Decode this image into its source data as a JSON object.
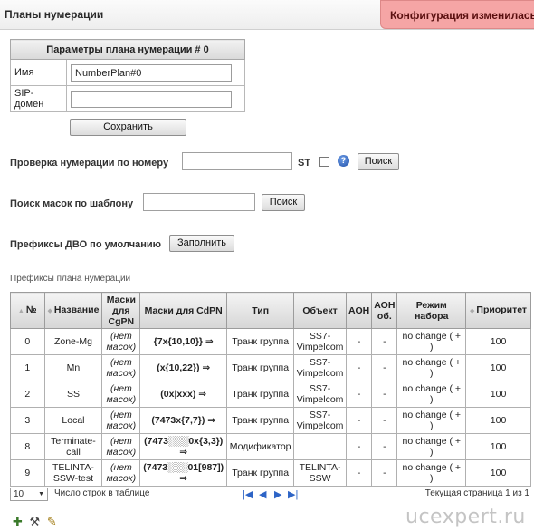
{
  "header": {
    "title": "Планы нумерации",
    "notice": "Конфигурация изменилась,"
  },
  "params": {
    "title": "Параметры плана нумерации # 0",
    "name_label": "Имя",
    "name_value": "NumberPlan#0",
    "sip_label": "SIP-домен",
    "sip_value": "",
    "save_label": "Сохранить"
  },
  "check": {
    "label": "Проверка нумерации по номеру",
    "st_label": "ST",
    "search_label": "Поиск"
  },
  "mask_search": {
    "label": "Поиск масок по шаблону",
    "search_label": "Поиск"
  },
  "vas": {
    "label": "Префиксы ДВО по умолчанию",
    "fill_label": "Заполнить"
  },
  "prefixes": {
    "section_title": "Префиксы плана нумерации",
    "columns": [
      "№",
      "Название",
      "Маски для CgPN",
      "Маски для CdPN",
      "Тип",
      "Объект",
      "АОН",
      "АОН об.",
      "Режим набора",
      "Приоритет"
    ],
    "rows": [
      {
        "num": "0",
        "name": "Zone-Mg",
        "cgpn": "(нет масок)",
        "cdpn": "{7x{10,10}} ⇒",
        "type": "Транк группа",
        "object": "SS7-Vimpelcom",
        "aon": "-",
        "aon_ob": "-",
        "mode": "no change ( + )",
        "priority": "100"
      },
      {
        "num": "1",
        "name": "Mn",
        "cgpn": "(нет масок)",
        "cdpn": "(x{10,22}) ⇒",
        "type": "Транк группа",
        "object": "SS7-Vimpelcom",
        "aon": "-",
        "aon_ob": "-",
        "mode": "no change ( + )",
        "priority": "100"
      },
      {
        "num": "2",
        "name": "SS",
        "cgpn": "(нет масок)",
        "cdpn": "(0x|xxx) ⇒",
        "type": "Транк группа",
        "object": "SS7-Vimpelcom",
        "aon": "-",
        "aon_ob": "-",
        "mode": "no change ( + )",
        "priority": "100"
      },
      {
        "num": "3",
        "name": "Local",
        "cgpn": "(нет масок)",
        "cdpn": "(7473x{7,7}) ⇒",
        "type": "Транк группа",
        "object": "SS7-Vimpelcom",
        "aon": "-",
        "aon_ob": "-",
        "mode": "no change ( + )",
        "priority": "100"
      },
      {
        "num": "8",
        "name": "Terminate-call",
        "cgpn": "(нет масок)",
        "cdpn": "(7473░░░0x{3,3}) ⇒",
        "type": "Модификатор",
        "object": "",
        "aon": "-",
        "aon_ob": "-",
        "mode": "no change ( + )",
        "priority": "100"
      },
      {
        "num": "9",
        "name": "TELINTA-SSW-test",
        "cgpn": "(нет масок)",
        "cdpn": "(7473░░░01[987]) ⇒",
        "type": "Транк группа",
        "object": "TELINTA-SSW",
        "aon": "-",
        "aon_ob": "-",
        "mode": "no change ( + )",
        "priority": "100"
      }
    ]
  },
  "pager": {
    "rows_value": "10",
    "rows_label": "Число строк в таблице",
    "page_info": "Текущая страница 1 из 1"
  },
  "watermark": "ucexpert.ru"
}
